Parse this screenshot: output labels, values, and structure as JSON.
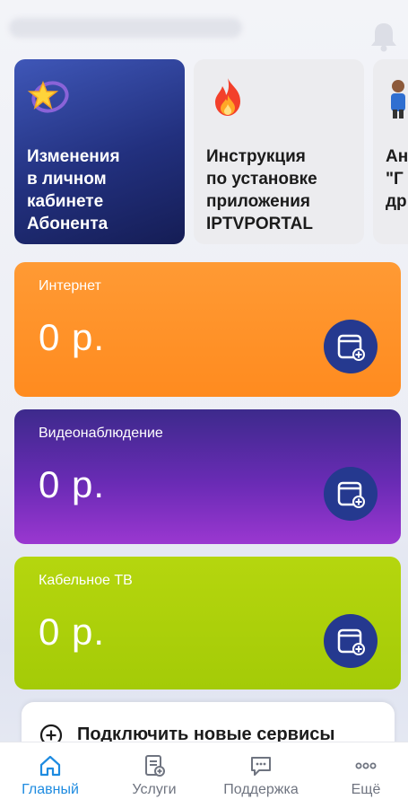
{
  "stories": [
    {
      "text": "Изменения\nв личном\nкабинете\nАбонента",
      "icon": "star-icon"
    },
    {
      "text": "Инструкция\nпо установке\nприложения\nIPTVPORTAL",
      "icon": "fire-icon"
    },
    {
      "text": "Ан\n\"Г\nдр",
      "icon": "person-icon"
    }
  ],
  "cards": [
    {
      "title": "Интернет",
      "amount": "0 р.",
      "color": "#ff9226"
    },
    {
      "title": "Видеонаблюдение",
      "amount": "0 р.",
      "color": "#6a2bb5"
    },
    {
      "title": "Кабельное ТВ",
      "amount": "0 р.",
      "color": "#aacf0a"
    }
  ],
  "connect": {
    "label": "Подключить новые сервисы"
  },
  "nav": {
    "home": "Главный",
    "services": "Услуги",
    "support": "Поддержка",
    "more": "Ещё"
  },
  "colors": {
    "accent": "#1e8be0",
    "button": "#25398f"
  }
}
